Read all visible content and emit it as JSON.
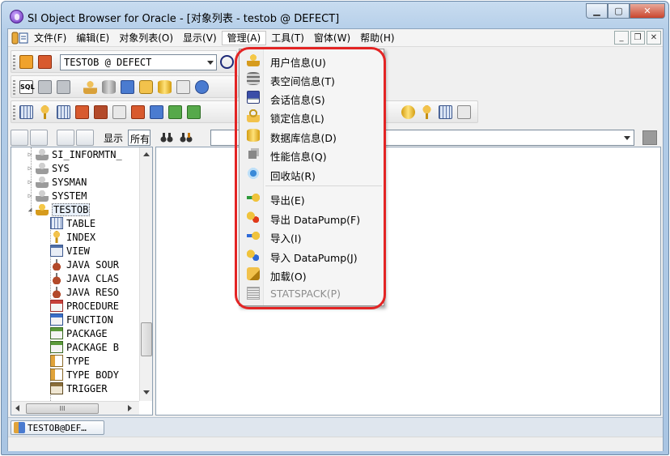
{
  "window": {
    "title": "SI Object Browser for Oracle - [对象列表 - testob @ DEFECT]",
    "min_glyph": "▁",
    "max_glyph": "▢",
    "close_glyph": "✕"
  },
  "menubar": {
    "items": [
      {
        "label": "文件(F)"
      },
      {
        "label": "编辑(E)"
      },
      {
        "label": "对象列表(O)"
      },
      {
        "label": "显示(V)"
      },
      {
        "label": "管理(A)"
      },
      {
        "label": "工具(T)"
      },
      {
        "label": "窗体(W)"
      },
      {
        "label": "帮助(H)"
      }
    ],
    "mdi": {
      "min": "_",
      "restore": "❐",
      "close": "✕"
    }
  },
  "toolbar": {
    "connection_value": "TESTOB @ DEFECT",
    "sql_label": "SQL"
  },
  "filter": {
    "show_label": "显示",
    "show_value": "所有"
  },
  "tree": {
    "items": [
      {
        "label": "SI_INFORMTN_",
        "icon": "user-icon"
      },
      {
        "label": "SYS",
        "icon": "user-icon"
      },
      {
        "label": "SYSMAN",
        "icon": "user-icon"
      },
      {
        "label": "SYSTEM",
        "icon": "user-icon"
      },
      {
        "label": "TESTOB",
        "icon": "user-active-icon"
      },
      {
        "label": "TABLE",
        "icon": "table-icon"
      },
      {
        "label": "INDEX",
        "icon": "index-icon"
      },
      {
        "label": "VIEW",
        "icon": "view-icon"
      },
      {
        "label": "JAVA SOUR",
        "icon": "java-icon"
      },
      {
        "label": "JAVA CLAS",
        "icon": "java-icon"
      },
      {
        "label": "JAVA RESO",
        "icon": "java-icon"
      },
      {
        "label": "PROCEDURE",
        "icon": "procedure-icon"
      },
      {
        "label": "FUNCTION",
        "icon": "function-icon"
      },
      {
        "label": "PACKAGE",
        "icon": "package-icon"
      },
      {
        "label": "PACKAGE B",
        "icon": "package-icon"
      },
      {
        "label": "TYPE",
        "icon": "type-icon"
      },
      {
        "label": "TYPE BODY",
        "icon": "type-icon"
      },
      {
        "label": "TRIGGER",
        "icon": "trigger-icon"
      }
    ],
    "hscroll_thumb_glyph": "III"
  },
  "dropdown": {
    "items": [
      {
        "label": "用户信息(U)",
        "icon": "user-info-icon",
        "enabled": true
      },
      {
        "label": "表空间信息(T)",
        "icon": "tablespace-icon",
        "enabled": true
      },
      {
        "label": "会话信息(S)",
        "icon": "session-icon",
        "enabled": true
      },
      {
        "label": "锁定信息(L)",
        "icon": "lock-icon",
        "enabled": true
      },
      {
        "label": "数据库信息(D)",
        "icon": "database-icon",
        "enabled": true
      },
      {
        "label": "性能信息(Q)",
        "icon": "performance-icon",
        "enabled": true
      },
      {
        "label": "回收站(R)",
        "icon": "recycle-bin-icon",
        "enabled": true
      },
      {
        "label": "导出(E)",
        "icon": "export-icon",
        "enabled": true
      },
      {
        "label": "导出 DataPump(F)",
        "icon": "export-datapump-icon",
        "enabled": true
      },
      {
        "label": "导入(I)",
        "icon": "import-icon",
        "enabled": true
      },
      {
        "label": "导入 DataPump(J)",
        "icon": "import-datapump-icon",
        "enabled": true
      },
      {
        "label": "加载(O)",
        "icon": "load-icon",
        "enabled": true
      },
      {
        "label": "STATSPACK(P)",
        "icon": "statspack-icon",
        "enabled": false
      }
    ]
  },
  "tabs": [
    {
      "label": "TESTOB@DEF…"
    }
  ],
  "colors": {
    "highlight_outline": "#e32424",
    "titlebar": "#b3cde8"
  }
}
